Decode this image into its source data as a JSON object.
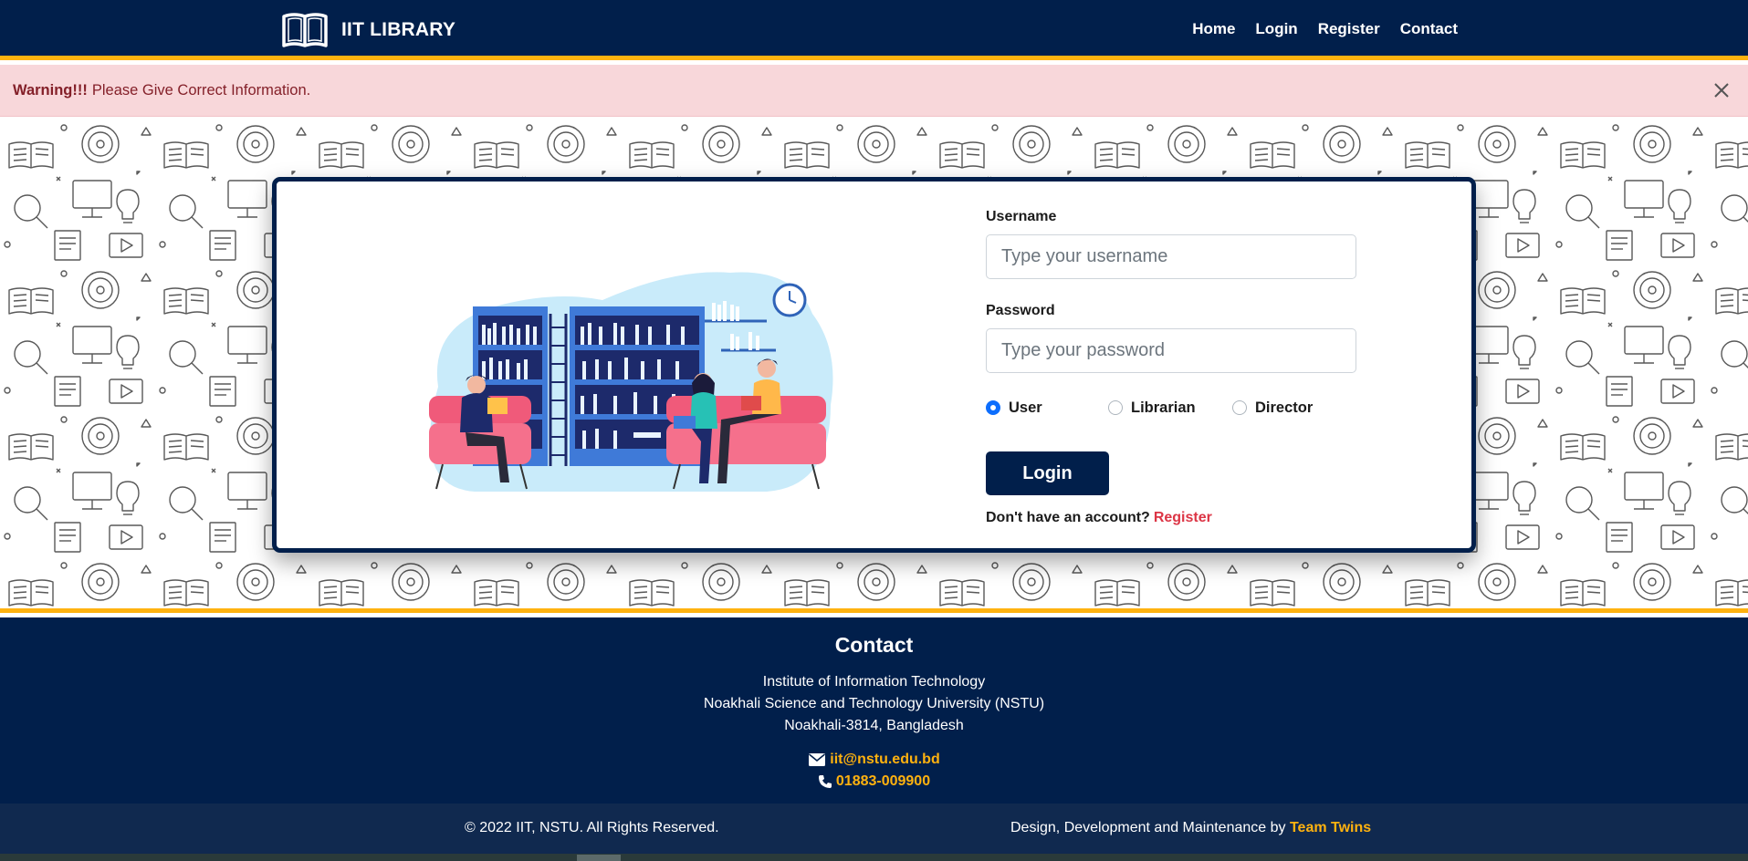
{
  "navbar": {
    "brand": "IIT LIBRARY",
    "links": [
      "Home",
      "Login",
      "Register",
      "Contact"
    ]
  },
  "alert": {
    "strong": "Warning!!!",
    "message": "Please Give Correct Information."
  },
  "form": {
    "username_label": "Username",
    "username_placeholder": "Type your username",
    "password_label": "Password",
    "password_placeholder": "Type your password",
    "roles": [
      {
        "label": "User",
        "checked": true
      },
      {
        "label": "Librarian",
        "checked": false
      },
      {
        "label": "Director",
        "checked": false
      }
    ],
    "login_label": "Login",
    "no_account_text": "Don't have an account?",
    "register_link": "Register"
  },
  "footer": {
    "title": "Contact",
    "address": [
      "Institute of Information Technology",
      "Noakhali Science and Technology University (NSTU)",
      "Noakhali-3814, Bangladesh"
    ],
    "email": "iit@nstu.edu.bd",
    "phone": "01883-009900",
    "copyright": "© 2022 IIT, NSTU. All Rights Reserved.",
    "credit_prefix": "Design, Development and Maintenance by",
    "credit_team": "Team Twins"
  },
  "colors": {
    "navy": "#011f4b",
    "accent": "#ffb20f",
    "alert_bg": "#f8d7da",
    "alert_text": "#842029",
    "register": "#dc3545",
    "radio_checked": "#0d6efd"
  },
  "icons": [
    "book-icon",
    "close-icon",
    "envelope-icon",
    "phone-icon"
  ]
}
